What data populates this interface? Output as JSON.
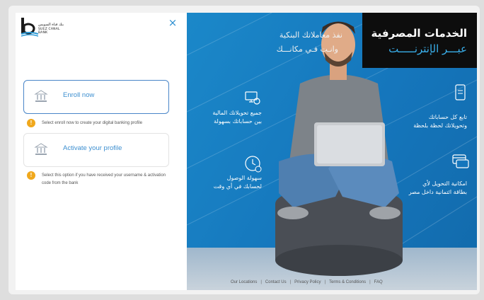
{
  "logo": {
    "arabic": "بنك قناة السويس",
    "english": "SUEZ CANAL BANK"
  },
  "close_label": "×",
  "options": [
    {
      "label": "Enroll now",
      "hint": "Select enroll now to create your digital banking profile"
    },
    {
      "label": "Activate your profile",
      "hint": "Select this option if you have received your username & activation code from the bank"
    }
  ],
  "promo": {
    "title_line1": "الخدمات المصرفية",
    "title_line2": "عبـــر الإنترنـــــت",
    "tagline_line1": "نفذ معاملاتك البنكية",
    "tagline_line2": "وانـت فـي مكانـــك",
    "features": [
      {
        "line1": "جميع تحويلاتك المالية",
        "line2": "بين حساباتك بسهولة"
      },
      {
        "line1": "سهولة الوصول",
        "line2": "لحسابك في أي وقت"
      },
      {
        "line1": "تابع كل حساباتك",
        "line2": "وتحويلاتك لحظة بلحظة"
      },
      {
        "line1": "امكانية التحويل لأي",
        "line2": "بطاقة ائتمانية داخل مصر"
      }
    ]
  },
  "footer_links": [
    "Our Locations",
    "Contact Us",
    "Privacy Policy",
    "Terms & Conditions",
    "FAQ"
  ],
  "colors": {
    "accent": "#3d8fd0",
    "warning": "#f0a81c",
    "promo_bg": "#1576bc",
    "promo_highlight": "#3ab0ec"
  }
}
